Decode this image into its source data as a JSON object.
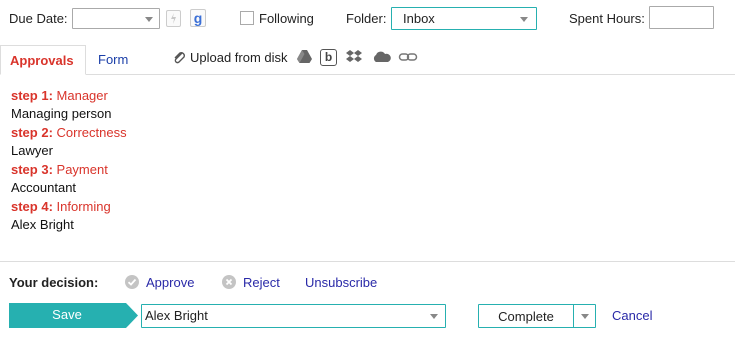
{
  "toolbar": {
    "due_date_label": "Due Date:",
    "following_label": "Following",
    "folder_label": "Folder:",
    "folder_value": "Inbox",
    "spent_hours_label": "Spent Hours:",
    "google_icon_text": "g",
    "box_icon_text": "b"
  },
  "tabs": {
    "approvals": "Approvals",
    "form": "Form",
    "upload": "Upload from disk"
  },
  "steps": [
    {
      "num": "step 1:",
      "name": "Manager",
      "assignee": "Managing person"
    },
    {
      "num": "step 2:",
      "name": "Correctness",
      "assignee": "Lawyer"
    },
    {
      "num": "step 3:",
      "name": "Payment",
      "assignee": "Accountant"
    },
    {
      "num": "step 4:",
      "name": "Informing",
      "assignee": "Alex Bright"
    }
  ],
  "decision": {
    "label": "Your decision:",
    "approve": "Approve",
    "reject": "Reject",
    "unsubscribe": "Unsubscribe"
  },
  "footer": {
    "save": "Save",
    "assignee_value": "Alex Bright",
    "complete": "Complete",
    "cancel": "Cancel"
  },
  "colors": {
    "accent_teal": "#26b0b0",
    "step_red": "#d9342b",
    "link_blue": "#2a2aa8"
  }
}
